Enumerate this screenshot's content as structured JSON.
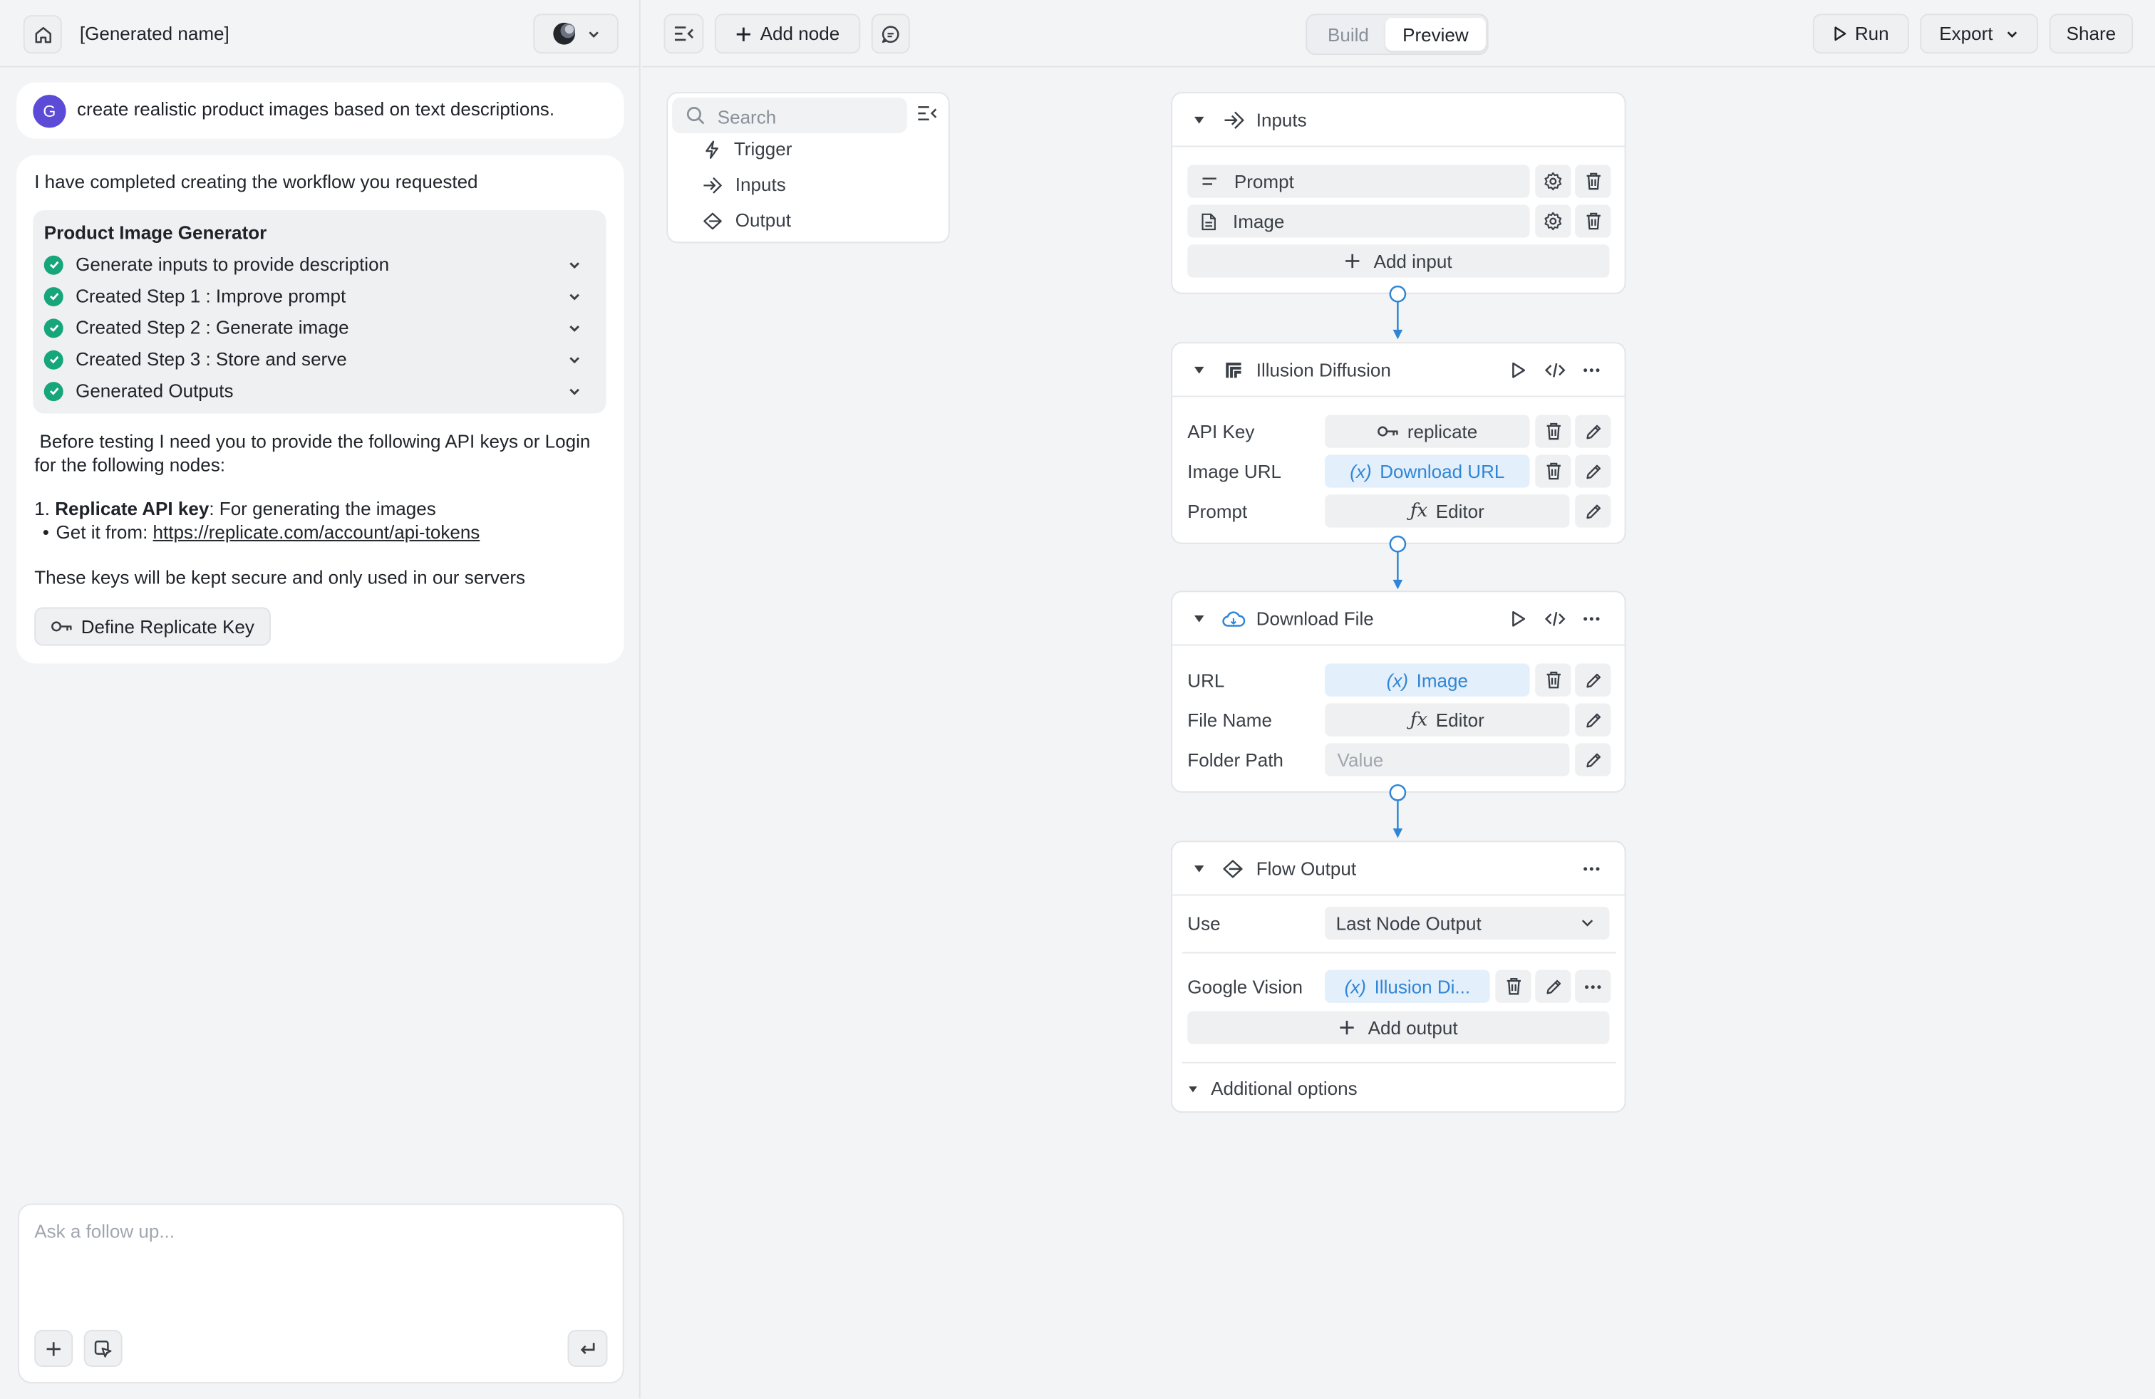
{
  "app": {
    "project_name": "[Generated name]"
  },
  "toolbar": {
    "add_node": "Add node",
    "mode_build": "Build",
    "mode_preview": "Preview",
    "run": "Run",
    "export": "Export",
    "share": "Share"
  },
  "chat": {
    "avatar_initial": "G",
    "user_message": "create realistic product images based on text descriptions.",
    "assistant_intro": "I have completed creating the workflow you requested",
    "workflow_title": "Product Image Generator",
    "steps": [
      {
        "label": "Generate inputs to provide description"
      },
      {
        "label": "Created Step 1 : Improve prompt"
      },
      {
        "label": "Created Step 2 : Generate image"
      },
      {
        "label": "Created Step 3 : Store and serve"
      },
      {
        "label": "Generated Outputs"
      }
    ],
    "request_text": " Before testing I need you to provide the following API keys or Login for the following nodes:",
    "key_number": "1.",
    "key_name": "Replicate API key",
    "key_desc": ": For generating the images",
    "get_from": "Get it from: ",
    "link": "https://replicate.com/account/api-tokens",
    "secure_note": "These keys will be kept secure and only used in our servers",
    "define_key_button": "Define Replicate Key",
    "input_placeholder": "Ask a follow up..."
  },
  "palette": {
    "search_placeholder": "Search",
    "items": [
      {
        "label": "Trigger"
      },
      {
        "label": "Inputs"
      },
      {
        "label": "Output"
      }
    ]
  },
  "nodes": {
    "inputs": {
      "title": "Inputs",
      "rows": [
        {
          "label": "Prompt"
        },
        {
          "label": "Image"
        }
      ],
      "add_input": "Add input"
    },
    "illusion": {
      "title": "Illusion Diffusion",
      "rows": [
        {
          "label": "API Key",
          "value": "replicate"
        },
        {
          "label": "Image URL",
          "value": "Download URL"
        },
        {
          "label": "Prompt",
          "value": "Editor"
        }
      ]
    },
    "download": {
      "title": "Download File",
      "rows": [
        {
          "label": "URL",
          "value": "Image"
        },
        {
          "label": "File Name",
          "value": "Editor"
        },
        {
          "label": "Folder Path",
          "placeholder": "Value"
        }
      ]
    },
    "output": {
      "title": "Flow Output",
      "use_label": "Use",
      "use_value": "Last Node Output",
      "output_label": "Google Vision",
      "output_value": "Illusion Di...",
      "add_output": "Add output",
      "additional": "Additional options"
    }
  },
  "colors": {
    "accent_blue": "#2f86d6",
    "success_green": "#16a67a",
    "avatar_purple": "#5b4bd6"
  }
}
